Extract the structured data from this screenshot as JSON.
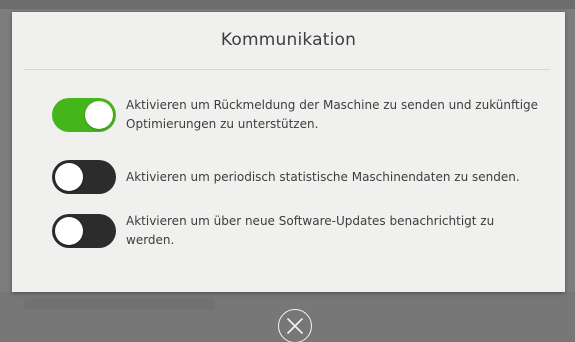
{
  "dialog": {
    "title": "Kommunikation",
    "options": [
      {
        "label": "Aktivieren um Rückmeldung der Maschine zu senden und zukünftige Optimierungen zu unterstützen.",
        "enabled": true
      },
      {
        "label": "Aktivieren um periodisch statistische Maschinendaten zu senden.",
        "enabled": false
      },
      {
        "label": "Aktivieren um über neue Software-Updates benachrichtigt zu werden.",
        "enabled": false
      }
    ]
  },
  "colors": {
    "toggle_on": "#45b51c",
    "toggle_off": "#2c2c2c",
    "dialog_bg": "#f0f0ef",
    "backdrop": "#7d7d7d"
  },
  "icons": {
    "close": "close-circle-icon"
  }
}
